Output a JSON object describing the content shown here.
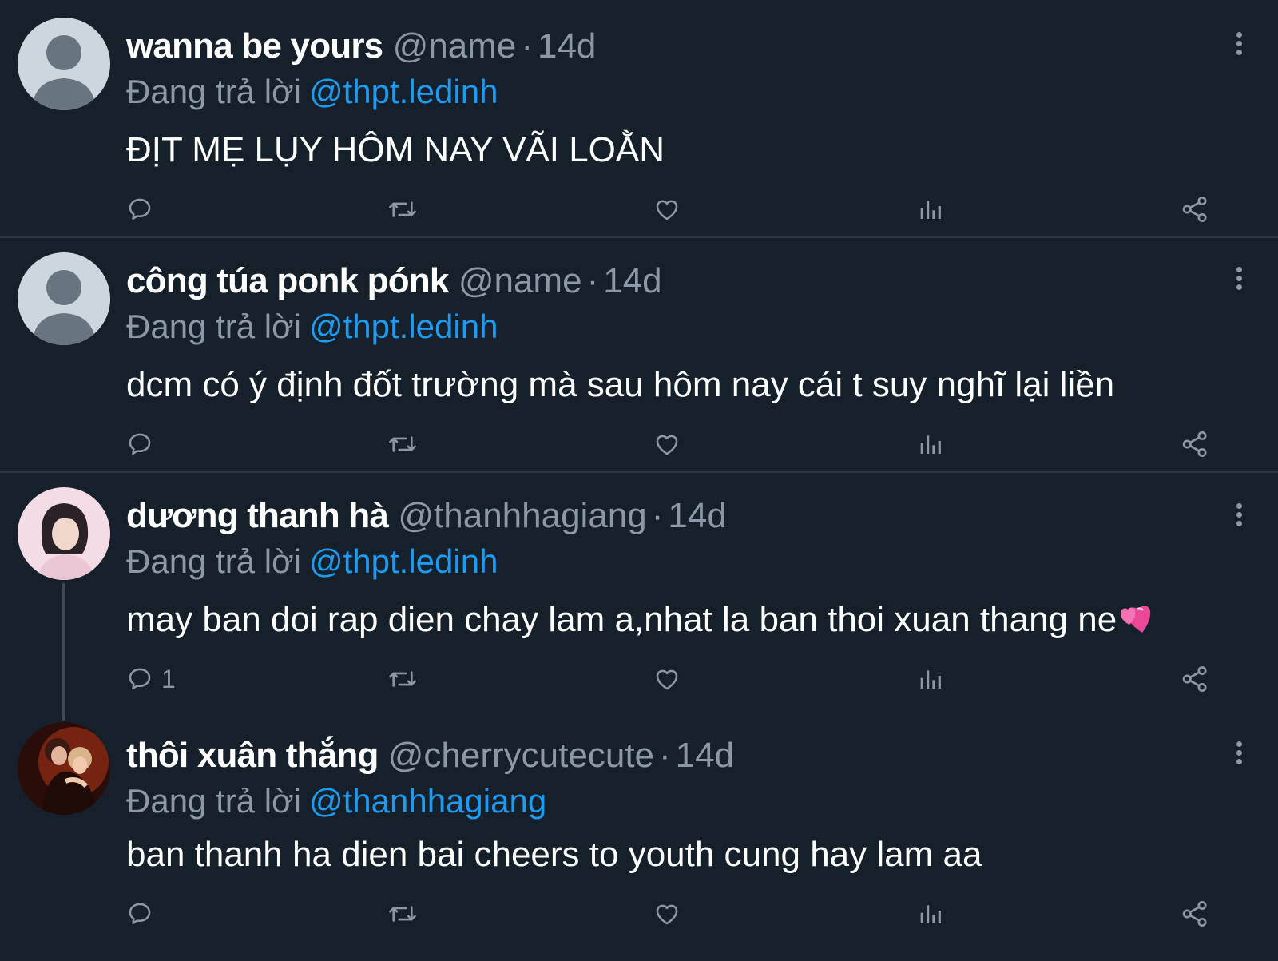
{
  "tweets": [
    {
      "name": "wanna be yours",
      "handle": "@name",
      "time": "14d",
      "replying_label": "Đang trả lời",
      "replying_to": "@thpt.ledinh",
      "text": "ĐỊT MẸ LỤY HÔM NAY VÃI LOẰN",
      "reply_count": "",
      "avatar": "default-avatar-icon"
    },
    {
      "name": "công túa ponk pónk",
      "handle": "@name",
      "time": "14d",
      "replying_label": "Đang trả lời",
      "replying_to": "@thpt.ledinh",
      "text": "dcm có ý định đốt trường mà sau hôm nay cái t suy nghĩ lại liền",
      "reply_count": "",
      "avatar": "default-avatar-icon"
    },
    {
      "name": "dương thanh hà",
      "handle": "@thanhhagiang",
      "time": "14d",
      "replying_label": "Đang trả lời",
      "replying_to": "@thpt.ledinh",
      "text": "may ban doi rap dien chay lam a,nhat la ban thoi xuan thang ne",
      "emoji": "two-hearts",
      "reply_count": "1",
      "avatar": "photo-avatar"
    },
    {
      "name": "thôi xuân thắng",
      "handle": "@cherrycutecute",
      "time": "14d",
      "replying_label": "Đang trả lời",
      "replying_to": "@thanhhagiang",
      "text": "ban thanh ha dien bai cheers to youth cung hay lam aa",
      "reply_count": "",
      "avatar": "photo-avatar"
    }
  ],
  "colors": {
    "background": "#15202b",
    "secondary_text": "#8b98a5",
    "mention": "#1d9bf0",
    "divider": "#2a3743"
  },
  "separator_dot": "·"
}
